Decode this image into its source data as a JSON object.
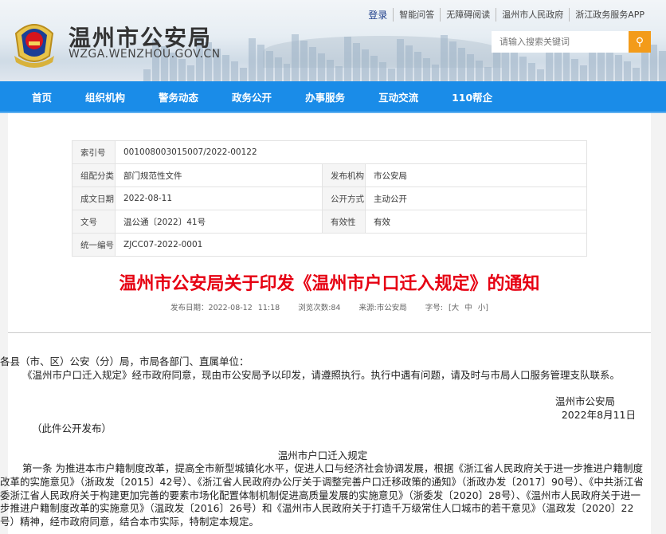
{
  "header": {
    "site_name": "温州市公安局",
    "site_url": "WZGA.WENZHOU.GOV.CN",
    "top_links": [
      "登录",
      "智能问答",
      "无障碍阅读",
      "温州市人民政府",
      "浙江政务服务APP"
    ],
    "search_placeholder": "请输入搜索关键词"
  },
  "nav": [
    "首页",
    "组织机构",
    "警务动态",
    "政务公开",
    "办事服务",
    "互动交流",
    "110帮企"
  ],
  "meta": {
    "index_label": "索引号",
    "index_value": "001008003015007/2022-00122",
    "category_label": "组配分类",
    "category_value": "部门规范性文件",
    "publisher_label": "发布机构",
    "publisher_value": "市公安局",
    "date_label": "成文日期",
    "date_value": "2022-08-11",
    "disclosure_label": "公开方式",
    "disclosure_value": "主动公开",
    "docno_label": "文号",
    "docno_value": "温公通〔2022〕41号",
    "validity_label": "有效性",
    "validity_value": "有效",
    "unified_label": "统一编号",
    "unified_value": "ZJCC07-2022-0001"
  },
  "article": {
    "title": "温州市公安局关于印发《温州市户口迁入规定》的通知",
    "publish_date": "发布日期：2022-08-12 11:18",
    "views": "浏览次数:84",
    "source": "来源:市公安局",
    "font_size": "字号: [大 中 小]",
    "salutation": "各县（市、区）公安（分）局，市局各部门、直属单位：",
    "p1": "《温州市户口迁入规定》经市政府同意，现由市公安局予以印发，请遵照执行。执行中遇有问题，请及时与市局人口服务管理支队联系。",
    "signer": "温州市公安局",
    "sign_date": "2022年8月11日",
    "public_note": "（此件公开发布）",
    "rule_title": "温州市户口迁入规定",
    "art1": "第一条  为推进本市户籍制度改革，提高全市新型城镇化水平，促进人口与经济社会协调发展，根据《浙江省人民政府关于进一步推进户籍制度改革的实施意见》（浙政发〔2015〕42号）、《浙江省人民政府办公厅关于调整完善户口迁移政策的通知》（浙政办发〔2017〕90号）、《中共浙江省委浙江省人民政府关于构建更加完善的要素市场化配置体制机制促进高质量发展的实施意见》（浙委发〔2020〕28号）、《温州市人民政府关于进一步推进户籍制度改革的实施意见》（温政发〔2016〕26号）和《温州市人民政府关于打造千万级常住人口城市的若干意见》（温政发〔2020〕22号）精神，经市政府同意，结合本市实际，特制定本规定。"
  }
}
